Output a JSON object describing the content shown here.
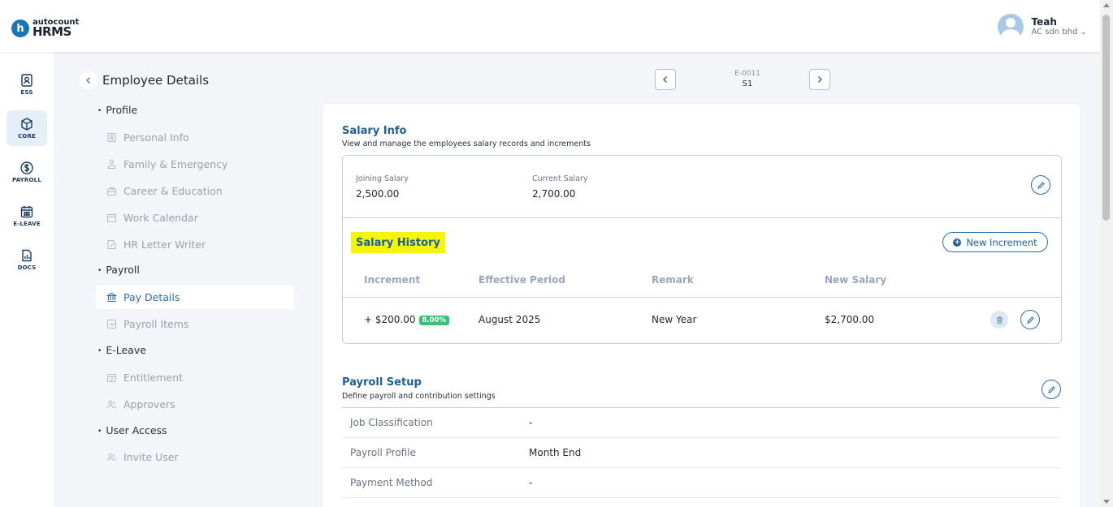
{
  "header": {
    "logo_mark": "h",
    "logo_brand": "autocount",
    "logo_product": "HRMS",
    "user_name": "Teah",
    "user_company": "AC sdn bhd ⌄"
  },
  "rail": [
    {
      "label": "ESS",
      "icon": "id-card-icon",
      "active": false
    },
    {
      "label": "CORE",
      "icon": "cube-icon",
      "active": true
    },
    {
      "label": "PAYROLL",
      "icon": "dollar-icon",
      "active": false
    },
    {
      "label": "E-LEAVE",
      "icon": "calendar-icon",
      "active": false
    },
    {
      "label": "DOCS",
      "icon": "document-chart-icon",
      "active": false
    }
  ],
  "subnav": {
    "title": "Employee Details",
    "sections": [
      {
        "label": "Profile",
        "items": [
          "Personal Info",
          "Family & Emergency",
          "Career & Education",
          "Work Calendar",
          "HR Letter Writer"
        ]
      },
      {
        "label": "Payroll",
        "items": [
          "Pay Details",
          "Payroll Items"
        ]
      },
      {
        "label": "E-Leave",
        "items": [
          "Entitlement",
          "Approvers"
        ]
      },
      {
        "label": "User Access",
        "items": [
          "Invite User"
        ]
      }
    ],
    "active_item": "Pay Details"
  },
  "record_nav": {
    "code": "E-0011",
    "name": "S1"
  },
  "salary_info": {
    "title": "Salary Info",
    "subtitle": "View and manage the employees salary records and increments",
    "joining_label": "Joining Salary",
    "joining_value": "2,500.00",
    "current_label": "Current Salary",
    "current_value": "2,700.00"
  },
  "salary_history": {
    "title": "Salary History",
    "new_button": "New Increment",
    "columns": [
      "Increment",
      "Effective Period",
      "Remark",
      "New Salary"
    ],
    "rows": [
      {
        "increment": "+ $200.00",
        "percent": "8.00%",
        "period": "August 2025",
        "remark": "New Year",
        "new_salary": "$2,700.00"
      }
    ]
  },
  "payroll_setup": {
    "title": "Payroll Setup",
    "subtitle": "Define payroll and contribution settings",
    "rows": [
      {
        "label": "Job Classification",
        "value": "-"
      },
      {
        "label": "Payroll Profile",
        "value": "Month End"
      },
      {
        "label": "Payment Method",
        "value": "-"
      }
    ]
  },
  "colors": {
    "brand": "#1a74b8",
    "accent": "#2b6cb0",
    "highlight": "#f5f50a",
    "badge_green": "#35c27a"
  }
}
